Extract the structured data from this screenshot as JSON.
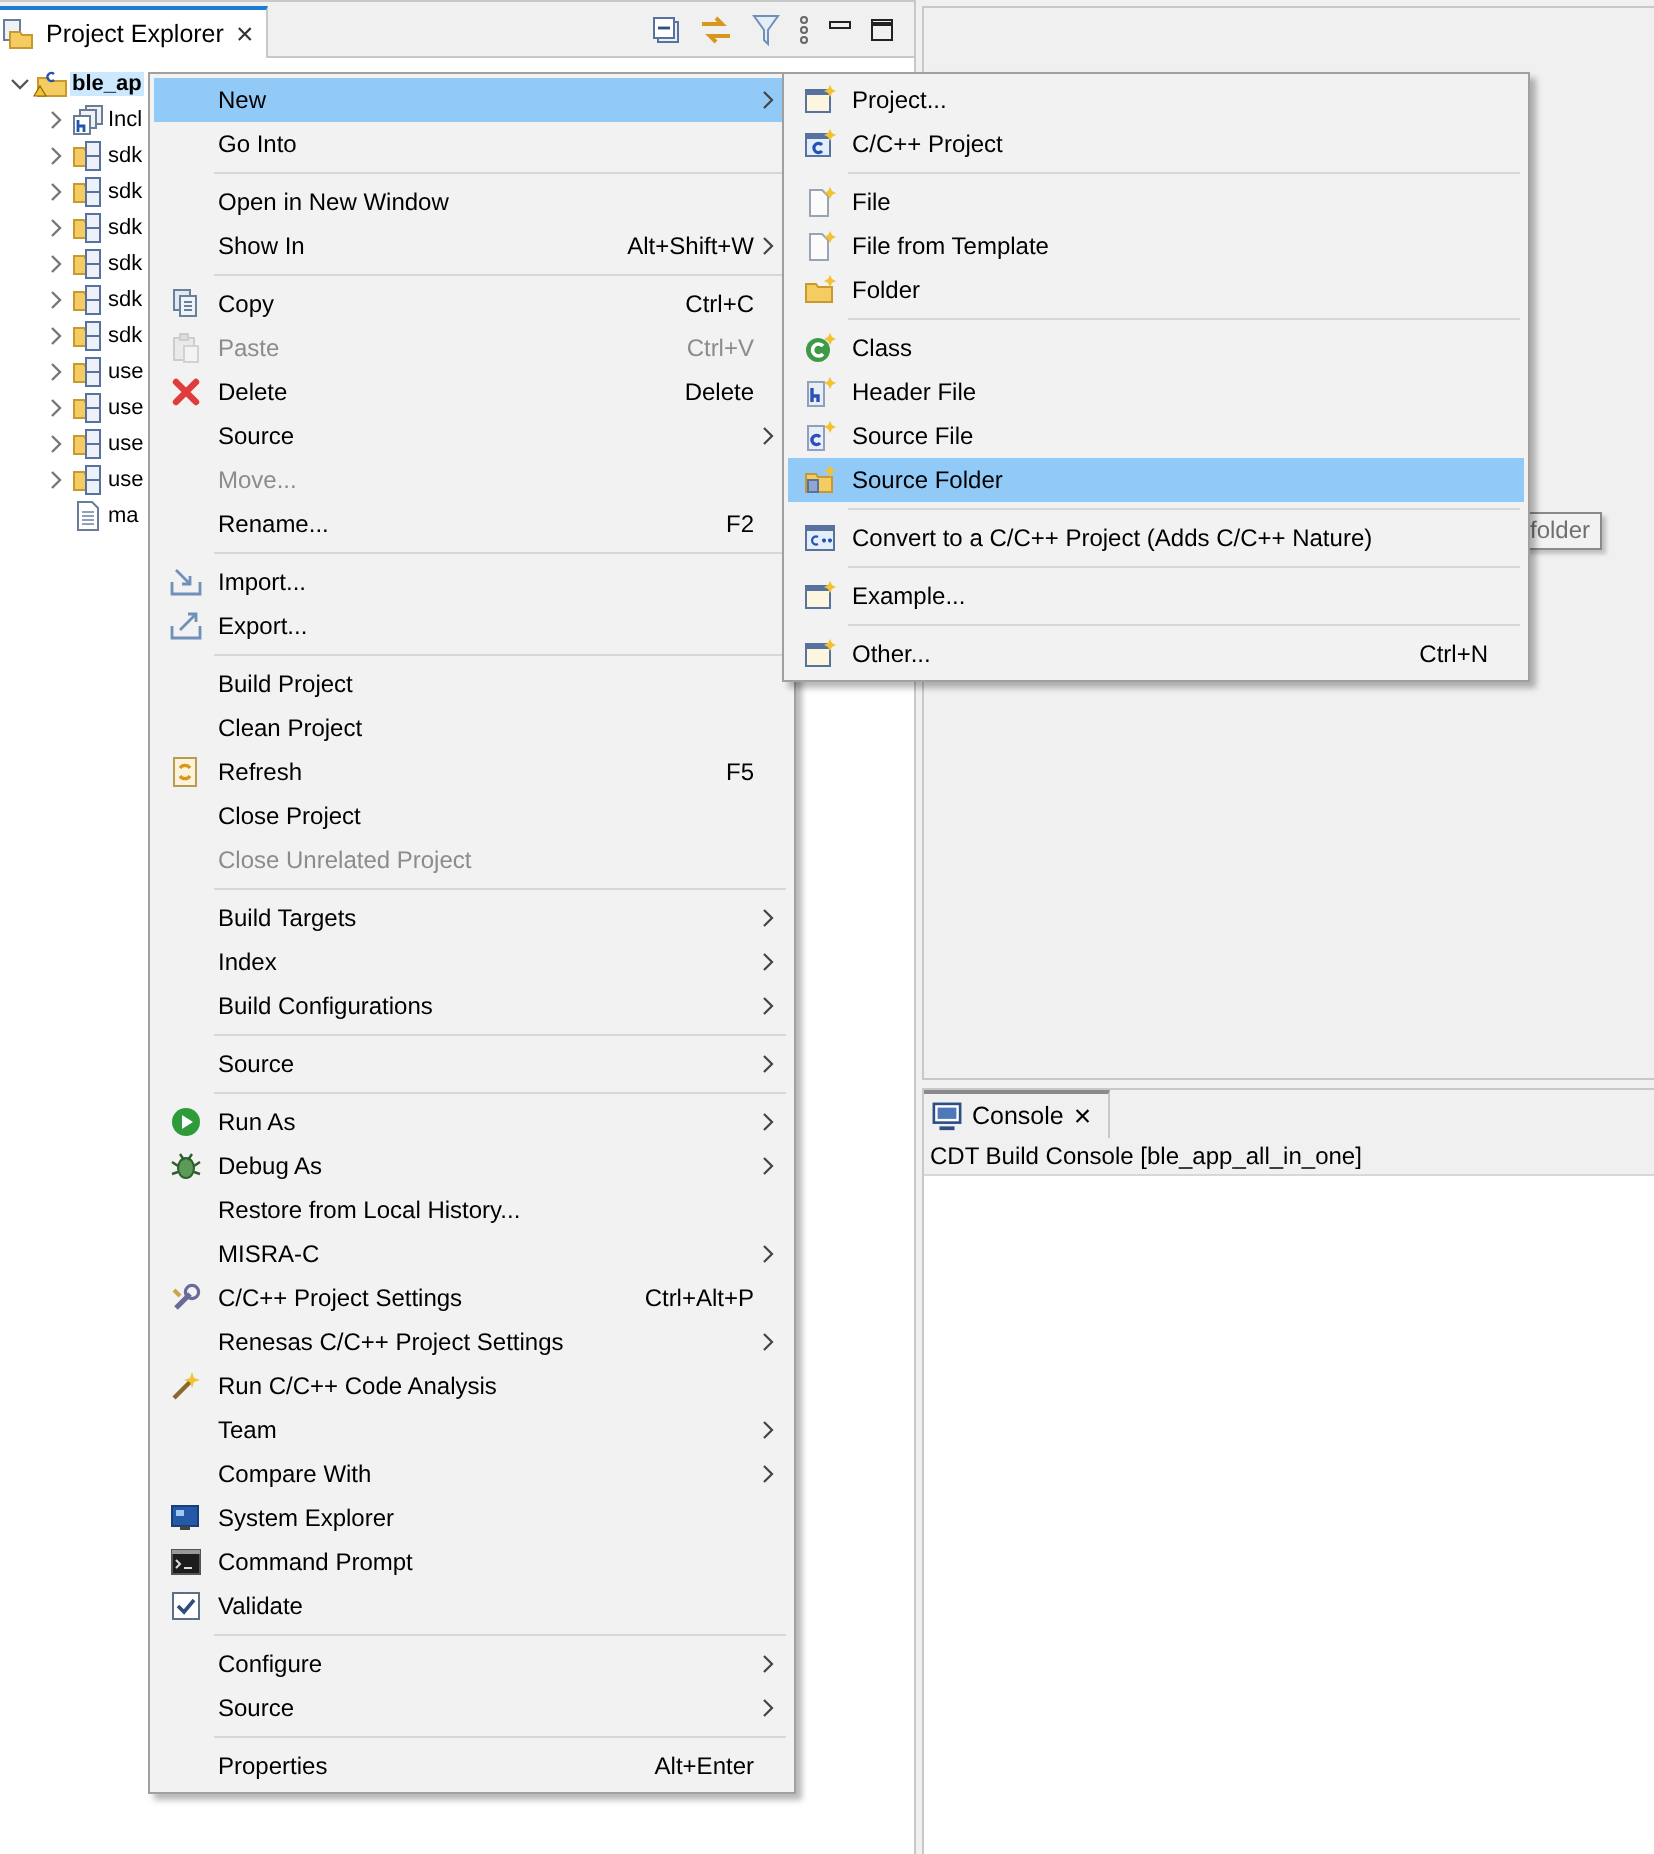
{
  "explorer": {
    "tab": {
      "label": "Project Explorer",
      "close": "×"
    },
    "tree": [
      {
        "label": "ble_ap",
        "kind": "project",
        "selected": true,
        "expanded": true,
        "children": [
          {
            "label": "Incl",
            "kind": "includes",
            "selected": false,
            "expanded": false
          },
          {
            "label": "sdk",
            "kind": "folder",
            "selected": false,
            "expanded": false
          },
          {
            "label": "sdk",
            "kind": "folder",
            "selected": false,
            "expanded": false
          },
          {
            "label": "sdk",
            "kind": "folder",
            "selected": false,
            "expanded": false
          },
          {
            "label": "sdk",
            "kind": "folder",
            "selected": false,
            "expanded": false
          },
          {
            "label": "sdk",
            "kind": "folder",
            "selected": false,
            "expanded": false
          },
          {
            "label": "sdk",
            "kind": "folder",
            "selected": false,
            "expanded": false
          },
          {
            "label": "use",
            "kind": "folder",
            "selected": false,
            "expanded": false
          },
          {
            "label": "use",
            "kind": "folder",
            "selected": false,
            "expanded": false
          },
          {
            "label": "use",
            "kind": "folder",
            "selected": false,
            "expanded": false
          },
          {
            "label": "use",
            "kind": "folder",
            "selected": false,
            "expanded": false
          },
          {
            "label": "ma",
            "kind": "file",
            "selected": false
          }
        ]
      }
    ]
  },
  "console": {
    "tab": {
      "label": "Console",
      "close": "×"
    },
    "header": "CDT Build Console [ble_app_all_in_one]"
  },
  "context_menu": {
    "items": [
      {
        "kind": "item",
        "label": "New",
        "submenu": true,
        "selected": true,
        "disabled": false
      },
      {
        "kind": "item",
        "label": "Go Into",
        "selected": false,
        "disabled": false
      },
      {
        "kind": "separator"
      },
      {
        "kind": "item",
        "label": "Open in New Window",
        "selected": false,
        "disabled": false
      },
      {
        "kind": "item",
        "label": "Show In",
        "shortcut": "Alt+Shift+W",
        "submenu": true,
        "selected": false,
        "disabled": false
      },
      {
        "kind": "separator"
      },
      {
        "kind": "item",
        "label": "Copy",
        "shortcut": "Ctrl+C",
        "selected": false,
        "disabled": false
      },
      {
        "kind": "item",
        "label": "Paste",
        "shortcut": "Ctrl+V",
        "selected": false,
        "disabled": true
      },
      {
        "kind": "item",
        "label": "Delete",
        "shortcut": "Delete",
        "selected": false,
        "disabled": false
      },
      {
        "kind": "item",
        "label": "Source",
        "submenu": true,
        "selected": false,
        "disabled": false
      },
      {
        "kind": "item",
        "label": "Move...",
        "selected": false,
        "disabled": true
      },
      {
        "kind": "item",
        "label": "Rename...",
        "shortcut": "F2",
        "selected": false,
        "disabled": false
      },
      {
        "kind": "separator"
      },
      {
        "kind": "item",
        "label": "Import...",
        "selected": false,
        "disabled": false
      },
      {
        "kind": "item",
        "label": "Export...",
        "selected": false,
        "disabled": false
      },
      {
        "kind": "separator"
      },
      {
        "kind": "item",
        "label": "Build Project",
        "selected": false,
        "disabled": false
      },
      {
        "kind": "item",
        "label": "Clean Project",
        "selected": false,
        "disabled": false
      },
      {
        "kind": "item",
        "label": "Refresh",
        "shortcut": "F5",
        "selected": false,
        "disabled": false
      },
      {
        "kind": "item",
        "label": "Close Project",
        "selected": false,
        "disabled": false
      },
      {
        "kind": "item",
        "label": "Close Unrelated Project",
        "selected": false,
        "disabled": true
      },
      {
        "kind": "separator"
      },
      {
        "kind": "item",
        "label": "Build Targets",
        "submenu": true,
        "selected": false,
        "disabled": false
      },
      {
        "kind": "item",
        "label": "Index",
        "submenu": true,
        "selected": false,
        "disabled": false
      },
      {
        "kind": "item",
        "label": "Build Configurations",
        "submenu": true,
        "selected": false,
        "disabled": false
      },
      {
        "kind": "separator"
      },
      {
        "kind": "item",
        "label": "Source",
        "submenu": true,
        "selected": false,
        "disabled": false
      },
      {
        "kind": "separator"
      },
      {
        "kind": "item",
        "label": "Run As",
        "submenu": true,
        "selected": false,
        "disabled": false
      },
      {
        "kind": "item",
        "label": "Debug As",
        "submenu": true,
        "selected": false,
        "disabled": false
      },
      {
        "kind": "item",
        "label": "Restore from Local History...",
        "selected": false,
        "disabled": false
      },
      {
        "kind": "item",
        "label": "MISRA-C",
        "submenu": true,
        "selected": false,
        "disabled": false
      },
      {
        "kind": "item",
        "label": "C/C++ Project Settings",
        "shortcut": "Ctrl+Alt+P",
        "selected": false,
        "disabled": false
      },
      {
        "kind": "item",
        "label": "Renesas C/C++ Project Settings",
        "submenu": true,
        "selected": false,
        "disabled": false
      },
      {
        "kind": "item",
        "label": "Run C/C++ Code Analysis",
        "selected": false,
        "disabled": false
      },
      {
        "kind": "item",
        "label": "Team",
        "submenu": true,
        "selected": false,
        "disabled": false
      },
      {
        "kind": "item",
        "label": "Compare With",
        "submenu": true,
        "selected": false,
        "disabled": false
      },
      {
        "kind": "item",
        "label": "System Explorer",
        "selected": false,
        "disabled": false
      },
      {
        "kind": "item",
        "label": "Command Prompt",
        "selected": false,
        "disabled": false
      },
      {
        "kind": "item",
        "label": "Validate",
        "selected": false,
        "disabled": false
      },
      {
        "kind": "separator"
      },
      {
        "kind": "item",
        "label": "Configure",
        "submenu": true,
        "selected": false,
        "disabled": false
      },
      {
        "kind": "item",
        "label": "Source",
        "submenu": true,
        "selected": false,
        "disabled": false
      },
      {
        "kind": "separator"
      },
      {
        "kind": "item",
        "label": "Properties",
        "shortcut": "Alt+Enter",
        "selected": false,
        "disabled": false
      }
    ]
  },
  "new_submenu": {
    "items": [
      {
        "kind": "item",
        "label": "Project...",
        "selected": false,
        "disabled": false
      },
      {
        "kind": "item",
        "label": "C/C++ Project",
        "selected": false,
        "disabled": false
      },
      {
        "kind": "separator"
      },
      {
        "kind": "item",
        "label": "File",
        "selected": false,
        "disabled": false
      },
      {
        "kind": "item",
        "label": "File from Template",
        "selected": false,
        "disabled": false
      },
      {
        "kind": "item",
        "label": "Folder",
        "selected": false,
        "disabled": false
      },
      {
        "kind": "separator"
      },
      {
        "kind": "item",
        "label": "Class",
        "selected": false,
        "disabled": false
      },
      {
        "kind": "item",
        "label": "Header File",
        "selected": false,
        "disabled": false
      },
      {
        "kind": "item",
        "label": "Source File",
        "selected": false,
        "disabled": false
      },
      {
        "kind": "item",
        "label": "Source Folder",
        "selected": true,
        "disabled": false
      },
      {
        "kind": "separator"
      },
      {
        "kind": "item",
        "label": "Convert to a C/C++ Project (Adds C/C++ Nature)",
        "selected": false,
        "disabled": false
      },
      {
        "kind": "separator"
      },
      {
        "kind": "item",
        "label": "Example...",
        "selected": false,
        "disabled": false
      },
      {
        "kind": "separator"
      },
      {
        "kind": "item",
        "label": "Other...",
        "shortcut": "Ctrl+N",
        "selected": false,
        "disabled": false
      }
    ]
  },
  "tooltip": {
    "text": "folder"
  }
}
